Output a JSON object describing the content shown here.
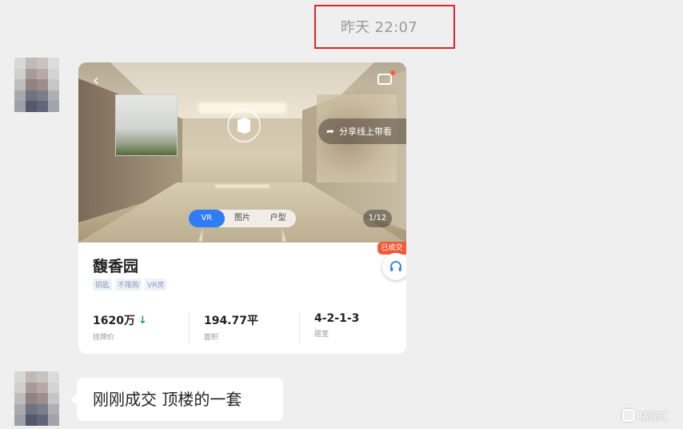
{
  "timestamp": "昨天 22:07",
  "card": {
    "share_label": "分享线上带看",
    "segments": [
      "VR",
      "图片",
      "户型"
    ],
    "active_segment": "VR",
    "page_count": "1/12",
    "sold_tag": "已成交",
    "property_name": "馥香园",
    "tags": [
      "钥匙",
      "不限购",
      "VR房"
    ],
    "stats": [
      {
        "value": "1620万",
        "label": "挂牌价"
      },
      {
        "value": "194.77平",
        "label": "面积"
      },
      {
        "value": "4-2-1-3",
        "label": "居室"
      }
    ]
  },
  "message": {
    "text": "刚刚成交 顶楼的一套"
  },
  "watermark": {
    "text": "格隆汇"
  },
  "icons": {
    "back": "back-arrow-icon",
    "chat": "chat-bubble-icon",
    "share": "share-arrow-icon",
    "vr": "vr-cube-icon",
    "support": "headset-icon",
    "price_trend": "down-arrow-icon",
    "watermark": "gelonghui-logo-icon"
  },
  "colors": {
    "highlight_border": "#e0242a",
    "active_segment": "#2f7cf6",
    "sold_tag": "#f15b3c",
    "price_down": "#1fa35a",
    "background": "#efefef"
  }
}
